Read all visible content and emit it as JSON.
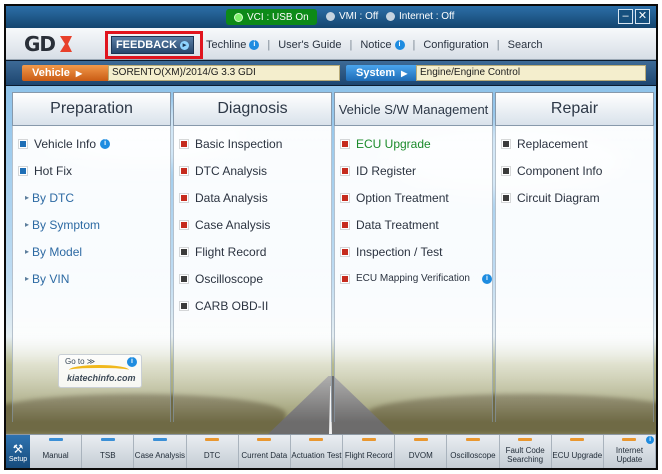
{
  "status": {
    "vci": "VCI : USB On",
    "vmi": "VMI : Off",
    "internet": "Internet : Off"
  },
  "window": {
    "minimize": "–",
    "close": "✕"
  },
  "toolbar": {
    "logo": "GD",
    "feedback": "FEEDBACK",
    "menu": [
      {
        "label": "Techline",
        "badge": true
      },
      {
        "label": "User's Guide",
        "badge": false
      },
      {
        "label": "Notice",
        "badge": true
      },
      {
        "label": "Configuration",
        "badge": false
      },
      {
        "label": "Search",
        "badge": false
      }
    ]
  },
  "context": {
    "vehicle_label": "Vehicle",
    "vehicle_value": "SORENTO(XM)/2014/G 3.3 GDI",
    "system_label": "System",
    "system_value": "Engine/Engine Control"
  },
  "columns": [
    {
      "title": "Preparation",
      "items": [
        {
          "label": "Vehicle Info",
          "type": "main",
          "color": "blue",
          "badge": true
        },
        {
          "label": "Hot Fix",
          "type": "main",
          "color": "blue"
        },
        {
          "label": "By DTC",
          "type": "sub"
        },
        {
          "label": "By Symptom",
          "type": "sub"
        },
        {
          "label": "By Model",
          "type": "sub"
        },
        {
          "label": "By VIN",
          "type": "sub"
        }
      ]
    },
    {
      "title": "Diagnosis",
      "items": [
        {
          "label": "Basic Inspection",
          "type": "main",
          "color": "red"
        },
        {
          "label": "DTC Analysis",
          "type": "main",
          "color": "red"
        },
        {
          "label": "Data Analysis",
          "type": "main",
          "color": "red"
        },
        {
          "label": "Case Analysis",
          "type": "main",
          "color": "red"
        },
        {
          "label": "Flight Record",
          "type": "main",
          "color": "dark"
        },
        {
          "label": "Oscilloscope",
          "type": "main",
          "color": "dark"
        },
        {
          "label": "CARB OBD-II",
          "type": "main",
          "color": "dark"
        }
      ]
    },
    {
      "title": "Vehicle S/W Management",
      "items": [
        {
          "label": "ECU Upgrade",
          "type": "main",
          "color": "red",
          "green": true
        },
        {
          "label": "ID Register",
          "type": "main",
          "color": "red"
        },
        {
          "label": "Option Treatment",
          "type": "main",
          "color": "red"
        },
        {
          "label": "Data Treatment",
          "type": "main",
          "color": "red"
        },
        {
          "label": "Inspection / Test",
          "type": "main",
          "color": "red"
        },
        {
          "label": "ECU Mapping Verification",
          "type": "main",
          "color": "red",
          "badge": true,
          "small": true
        }
      ]
    },
    {
      "title": "Repair",
      "items": [
        {
          "label": "Replacement",
          "type": "main",
          "color": "dark"
        },
        {
          "label": "Component Info",
          "type": "main",
          "color": "dark"
        },
        {
          "label": "Circuit Diagram",
          "type": "main",
          "color": "dark"
        }
      ]
    }
  ],
  "kia_logo": {
    "goto": "Go to ≫",
    "site": "kiatechinfo.com"
  },
  "taskbar": {
    "setup": "Setup",
    "tabs": [
      {
        "label": "Manual",
        "bar": "blue"
      },
      {
        "label": "TSB",
        "bar": "blue"
      },
      {
        "label": "Case Analysis",
        "bar": "blue"
      },
      {
        "label": "DTC",
        "bar": "orange"
      },
      {
        "label": "Current Data",
        "bar": "orange"
      },
      {
        "label": "Actuation Test",
        "bar": "orange"
      },
      {
        "label": "Flight Record",
        "bar": "orange"
      },
      {
        "label": "DVOM",
        "bar": "orange"
      },
      {
        "label": "Oscilloscope",
        "bar": "orange"
      },
      {
        "label": "Fault Code Searching",
        "bar": "orange"
      },
      {
        "label": "ECU Upgrade",
        "bar": "orange"
      },
      {
        "label": "Internet Update",
        "bar": "orange",
        "badge": true
      }
    ]
  }
}
